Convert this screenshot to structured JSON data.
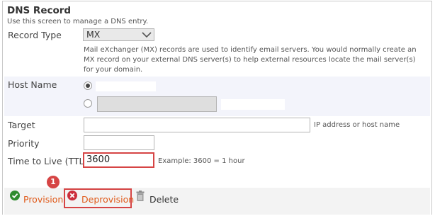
{
  "header": {
    "title": "DNS Record",
    "subtitle": "Use this screen to manage a DNS entry."
  },
  "record_type": {
    "label": "Record Type",
    "selected": "MX",
    "description": "Mail eXchanger (MX) records are used to identify email servers. You would normally create an MX record on your external DNS server(s) to help external resources locate the mail server(s) for your domain."
  },
  "host_name": {
    "label": "Host Name"
  },
  "target": {
    "label": "Target",
    "value": "",
    "hint": "IP address or host name"
  },
  "priority": {
    "label": "Priority",
    "value": ""
  },
  "ttl": {
    "label": "Time to Live (TTL)",
    "value": "3600",
    "hint": "Example: 3600 = 1 hour"
  },
  "toolbar": {
    "provision_label": "Provision",
    "deprovision_label": "Deprovision",
    "delete_label": "Delete"
  },
  "annotation": {
    "step_number": "1"
  },
  "colors": {
    "action_link": "#e05a1a",
    "annotation_red": "#d64545",
    "provision_green": "#2e8b2e",
    "deprovision_red": "#cc2e3c",
    "band_bg": "#f3f4fb"
  },
  "icons": {
    "provision": "check-circle-icon",
    "deprovision": "x-circle-icon",
    "delete": "trash-icon",
    "dropdown": "chevron-down-icon"
  }
}
